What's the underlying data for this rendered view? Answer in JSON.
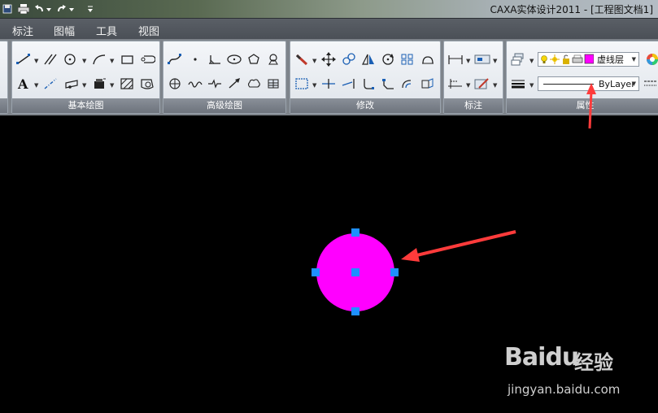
{
  "window": {
    "title": "CAXA实体设计2011 - [工程图文档1]"
  },
  "menu": {
    "items": [
      "标注",
      "图幅",
      "工具",
      "视图"
    ]
  },
  "ribbon": {
    "panels": [
      "基本绘图",
      "高级绘图",
      "修改",
      "标注",
      "属性"
    ],
    "layer_name": "虚线层",
    "layer_color": "#ff00ff",
    "linetype_label": "ByLayer"
  },
  "canvas": {
    "background": "#000000",
    "circle_color": "#ff00ff",
    "grip_color": "#1e90ff"
  },
  "annotations": {
    "arrow_color": "#ff3b3b"
  },
  "watermark": {
    "logo": "Baidu",
    "text": "经验",
    "url": "jingyan.baidu.com"
  }
}
